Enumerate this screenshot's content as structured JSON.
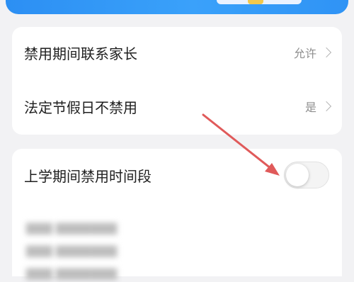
{
  "settings": {
    "items": [
      {
        "label": "禁用期间联系家长",
        "value": "允许"
      },
      {
        "label": "法定节假日不禁用",
        "value": "是"
      }
    ]
  },
  "school": {
    "label": "上学期间禁用时间段",
    "toggle_on": false
  },
  "colors": {
    "banner": "#2f93f5",
    "background": "#f2f2f4",
    "card": "#ffffff",
    "arrow": "#e05a5a"
  }
}
